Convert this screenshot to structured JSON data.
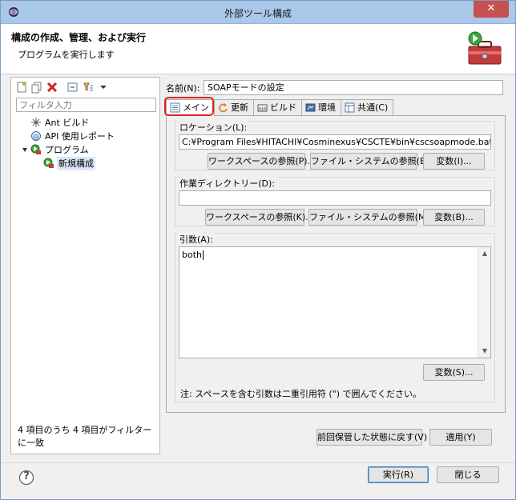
{
  "window": {
    "title": "外部ツール構成",
    "close_glyph": "✕"
  },
  "header": {
    "title": "構成の作成、管理、および実行",
    "subtitle": "プログラムを実行します"
  },
  "left": {
    "filter_placeholder": "フィルタ入力",
    "tree": [
      {
        "label": "Ant ビルド",
        "icon": "ant-icon"
      },
      {
        "label": "API 使用レポート",
        "icon": "api-report-icon"
      },
      {
        "label": "プログラム",
        "icon": "program-icon"
      },
      {
        "label": "新規構成",
        "icon": "new-config-icon"
      }
    ],
    "status": "4 項目のうち 4 項目がフィルターに一致"
  },
  "right": {
    "name_label": "名前(N):",
    "name_value": "SOAPモードの設定",
    "tabs": [
      {
        "label": "メイン",
        "icon": "main-tab-icon"
      },
      {
        "label": "更新",
        "icon": "refresh-tab-icon"
      },
      {
        "label": "ビルド",
        "icon": "build-tab-icon"
      },
      {
        "label": "環境",
        "icon": "environment-tab-icon"
      },
      {
        "label": "共通(C)",
        "icon": "common-tab-icon"
      }
    ],
    "location": {
      "label": "ロケーション(L):",
      "value": "C:¥Program Files¥HITACHI¥Cosminexus¥CSCTE¥bin¥cscsoapmode.bat",
      "workspace_btn": "ワークスペースの参照(P)...",
      "filesystem_btn": "ファイル・システムの参照(E)...",
      "variables_btn": "変数(I)..."
    },
    "workdir": {
      "label": "作業ディレクトリー(D):",
      "value": "",
      "workspace_btn": "ワークスペースの参照(K)...",
      "filesystem_btn": "ファイル・システムの参照(M)...",
      "variables_btn": "変数(B)..."
    },
    "args": {
      "label": "引数(A):",
      "value": "both",
      "variables_btn": "変数(S)...",
      "note": "注: スペースを含む引数は二重引用符 (\") で囲んでください。"
    },
    "revert_btn": "前回保管した状態に戻す(V)",
    "apply_btn": "適用(Y)"
  },
  "footer": {
    "help_glyph": "?",
    "run_btn": "実行(R)",
    "close_btn": "閉じる"
  },
  "colors": {
    "highlight": "#e02020",
    "titlebar": "#a9c8ea",
    "close": "#c75050"
  }
}
